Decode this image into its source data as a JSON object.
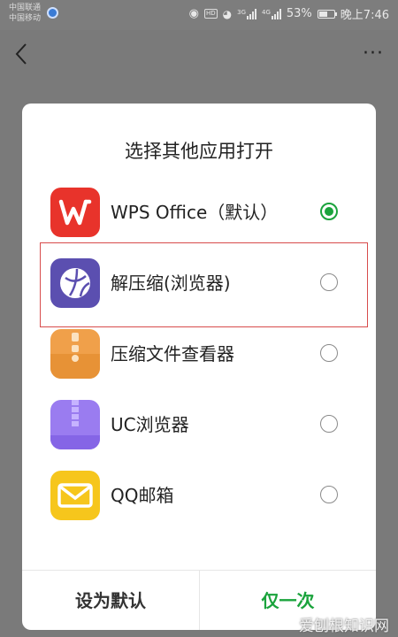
{
  "status_bar": {
    "carrier1": "中国联通",
    "carrier2": "中国移动",
    "hd": "HD",
    "net1": "3G",
    "net2": "4G",
    "battery": "53%",
    "time": "晚上7:46"
  },
  "nav": {
    "back_icon": "chevron-left-icon",
    "more_label": "···"
  },
  "dialog": {
    "title": "选择其他应用打开",
    "apps": [
      {
        "label": "WPS Office（默认）",
        "icon": "wps-office-icon",
        "selected": true
      },
      {
        "label": "解压缩(浏览器)",
        "icon": "browser-globe-icon",
        "selected": false
      },
      {
        "label": "压缩文件查看器",
        "icon": "archive-folder-icon",
        "selected": false
      },
      {
        "label": "UC浏览器",
        "icon": "zip-icon",
        "selected": false
      },
      {
        "label": "QQ邮箱",
        "icon": "mail-icon",
        "selected": false
      }
    ],
    "buttons": {
      "set_default": "设为默认",
      "once": "仅一次"
    }
  },
  "watermark": "爱刨根知识网",
  "colors": {
    "accent": "#1aa33c",
    "highlight": "#d84c4c"
  }
}
